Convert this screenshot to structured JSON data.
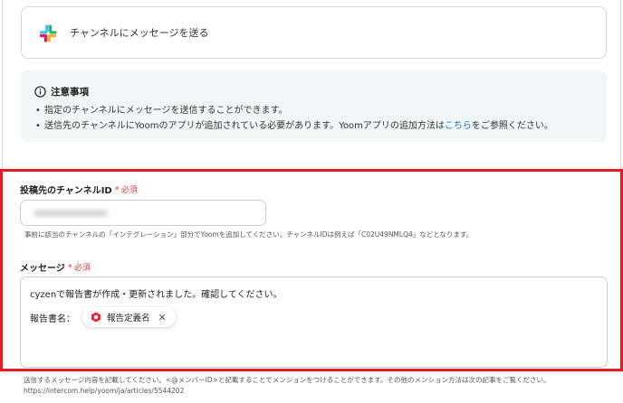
{
  "app": {
    "title": "チャンネルにメッセージを送る",
    "icon": "slack-icon"
  },
  "notice": {
    "title": "注意事項",
    "items": [
      {
        "text": "指定のチャンネルにメッセージを送信することができます。"
      },
      {
        "text_before": "送信先のチャンネルにYoomのアプリが追加されている必要があります。Yoomアプリの追加方法は",
        "link": "こちら",
        "text_after": "をご参照ください。"
      }
    ]
  },
  "fields": {
    "channel_id": {
      "label": "投稿先のチャンネルID",
      "required": "必須",
      "help": "事前に該当のチャンネルの「インテグレーション」部分でYoomを追加してください。チャンネルIDは例えば「C02U49NMLQ4」などとなります。"
    },
    "message": {
      "label": "メッセージ",
      "required": "必須",
      "line1": "cyzenで報告書が作成・更新されました。確認してください。",
      "line2_prefix": "報告書名：",
      "chip_label": "報告定義名",
      "help_line1": "送信するメッセージ内容を記載してください。<@メンバーID>と記載することでメンションをつけることができます。その他のメンション方法は次の記事をご覧ください。",
      "help_line2": "https://intercom.help/yoom/ja/articles/5544202"
    }
  },
  "colors": {
    "highlight": "#e8191c",
    "notice_bg": "#f0f7f6",
    "required": "#e03a3a",
    "link": "#1a73c7"
  }
}
